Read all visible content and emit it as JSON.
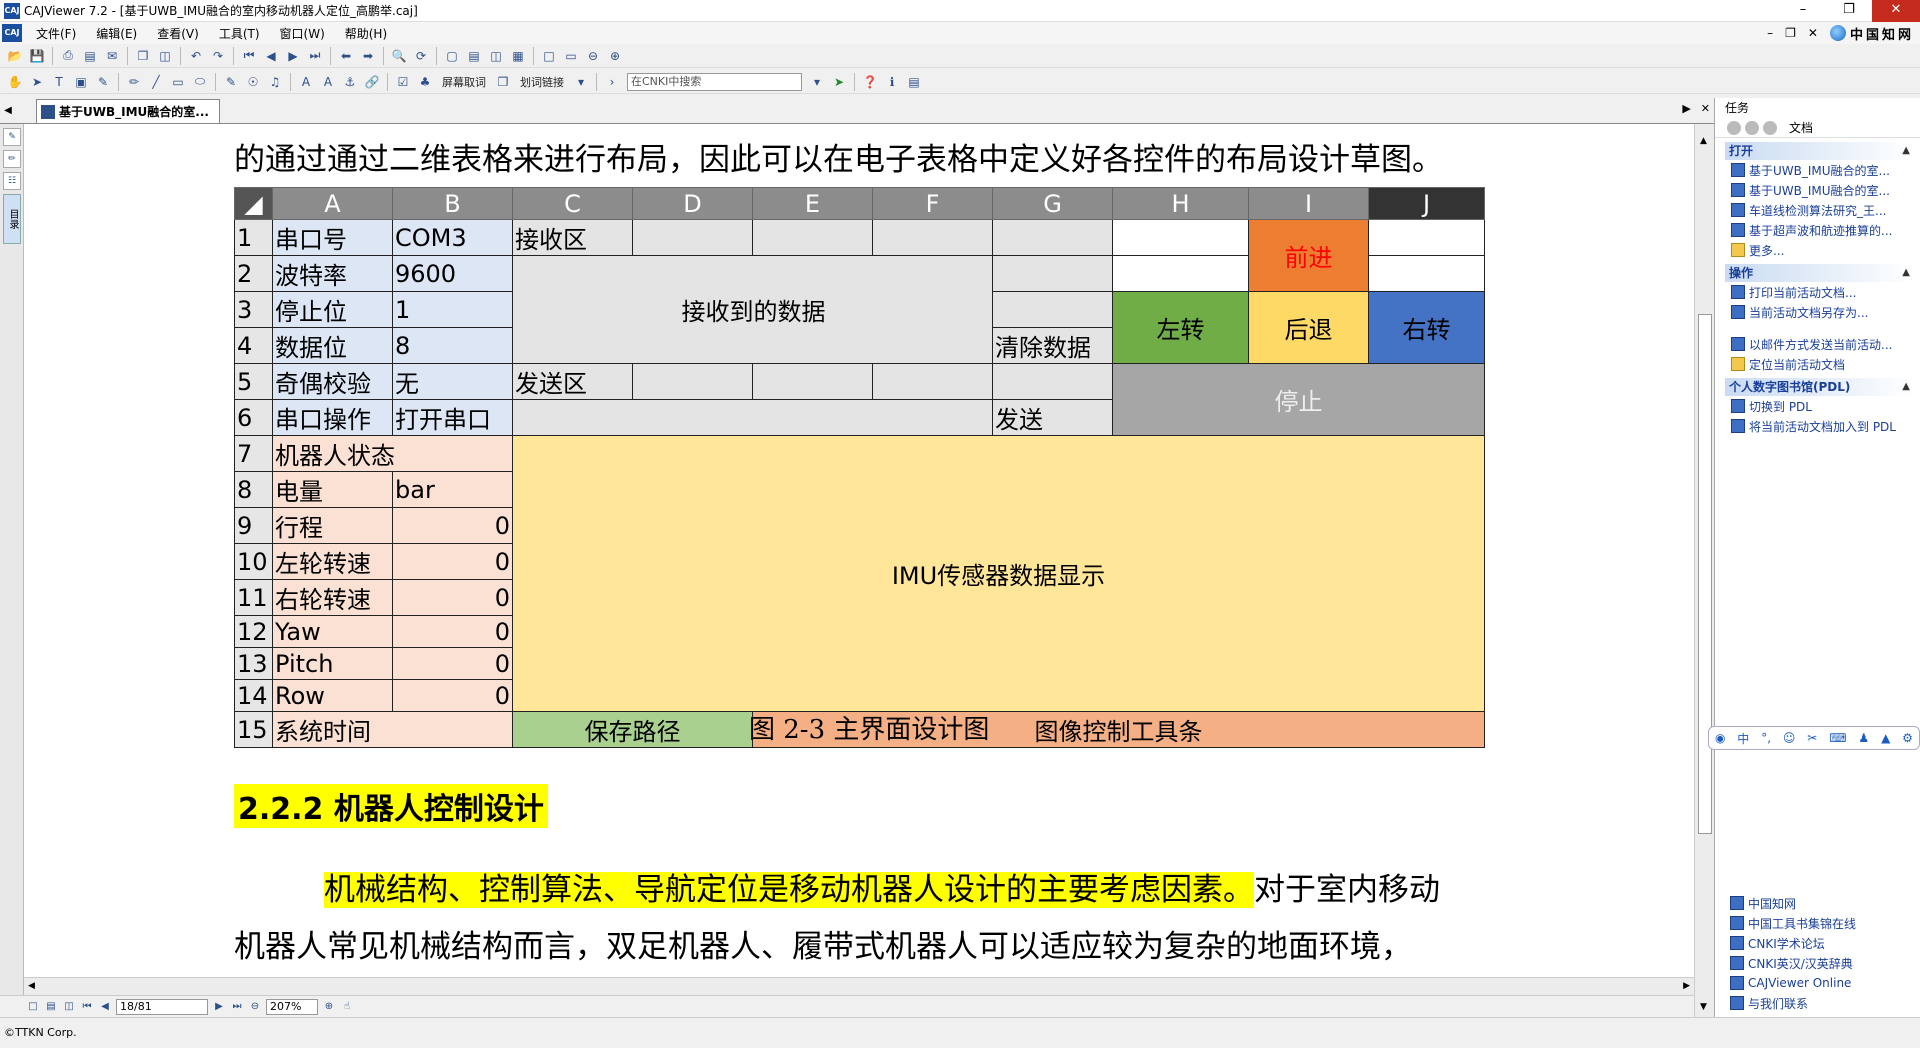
{
  "window": {
    "title": "CAJViewer 7.2 - [基于UWB_IMU融合的室内移动机器人定位_高鹏举.caj]",
    "logo": "CAJ"
  },
  "menu": {
    "items": [
      "文件(F)",
      "编辑(E)",
      "查看(V)",
      "工具(T)",
      "窗口(W)",
      "帮助(H)"
    ],
    "brand": "中国知网"
  },
  "toolbar": {
    "screen_pick": "屏幕取词",
    "word_link": "划词链接",
    "search_placeholder": "在CNKI中搜索"
  },
  "tab": {
    "label": "基于UWB_IMU融合的室..."
  },
  "left_strip": {
    "vertical_label": "目录"
  },
  "doc": {
    "line1": "的通过通过二维表格来进行布局，因此可以在电子表格中定义好各控件的布局设计草图。",
    "caption": "图  2-3  主界面设计图",
    "section": "2.2.2 机器人控制设计",
    "para1_hl": "机械结构、控制算法、导航定位是移动机器人设计的主要考虑因素。",
    "para1_rest": "对于室内移动",
    "para2": "机器人常见机械结构而言，双足机器人、履带式机器人可以适应较为复杂的地面环境，"
  },
  "grid": {
    "cols": [
      "A",
      "B",
      "C",
      "D",
      "E",
      "F",
      "G",
      "H",
      "I",
      "J"
    ],
    "rows": [
      "1",
      "2",
      "3",
      "4",
      "5",
      "6",
      "7",
      "8",
      "9",
      "10",
      "11",
      "12",
      "13",
      "14",
      "15"
    ],
    "cells": {
      "a1": "串口号",
      "b1": "COM3",
      "c1": "接收区",
      "a2": "波特率",
      "b2": "9600",
      "a3": "停止位",
      "b3": "1",
      "a4": "数据位",
      "b4": "8",
      "g4": "清除数据",
      "a5": "奇偶校验",
      "b5": "无",
      "c5": "发送区",
      "a6": "串口操作",
      "b6": "打开串口",
      "g6": "发送",
      "a7": "机器人状态",
      "a8": "电量",
      "b8": "bar",
      "a9": "行程",
      "b9": "0",
      "a10": "左轮转速",
      "b10": "0",
      "a11": "右轮转速",
      "b11": "0",
      "a12": "Yaw",
      "b12": "0",
      "a13": "Pitch",
      "b13": "0",
      "a14": "Row",
      "b14": "0",
      "a15": "系统时间",
      "recv_data": "接收到的数据",
      "imu": "IMU传感器数据显示",
      "save_path": "保存路径",
      "img_toolbar": "图像控制工具条",
      "fwd": "前进",
      "left": "左转",
      "back": "后退",
      "right": "右转",
      "stop": "停止"
    }
  },
  "status": {
    "page": "18/81",
    "zoom": "207%",
    "copyright": "©TTKN Corp."
  },
  "right_panel": {
    "title": "任务",
    "nav_label": "文档",
    "open_title": "打开",
    "open_items": [
      "基于UWB_IMU融合的室...",
      "基于UWB_IMU融合的室...",
      "车道线检测算法研究_王...",
      "基于超声波和航迹推算的...",
      "更多..."
    ],
    "ops_title": "操作",
    "ops_items": [
      "打印当前活动文档...",
      "当前活动文档另存为...",
      "以邮件方式发送当前活动...",
      "定位当前活动文档"
    ],
    "pdl_title": "个人数字图书馆(PDL)",
    "pdl_items": [
      "切换到 PDL",
      "将当前活动文档加入到 PDL"
    ],
    "links": [
      "中国知网",
      "中国工具书集锦在线",
      "CNKI学术论坛",
      "CNKI英汉/汉英辞典",
      "CAJViewer Online",
      "与我们联系"
    ]
  }
}
